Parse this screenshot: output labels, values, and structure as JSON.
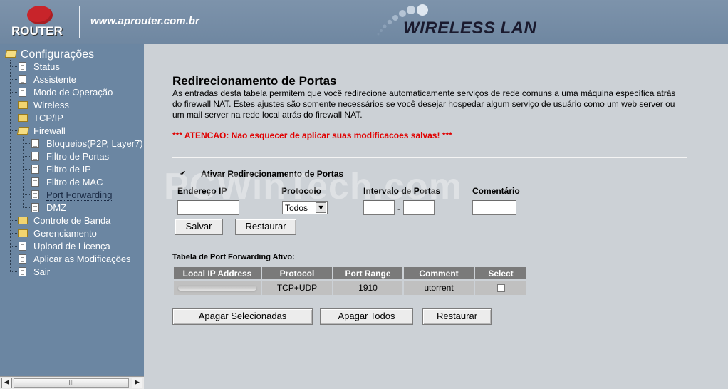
{
  "header": {
    "logo_text": "ROUTER",
    "site_url": "www.aprouter.com.br",
    "product_title": "WIRELESS LAN"
  },
  "sidebar": {
    "root_label": "Configurações",
    "items": [
      {
        "label": "Status"
      },
      {
        "label": "Assistente"
      },
      {
        "label": "Modo de Operação"
      },
      {
        "label": "Wireless"
      },
      {
        "label": "TCP/IP"
      },
      {
        "label": "Firewall"
      },
      {
        "label": "Bloqueios(P2P, Layer7)"
      },
      {
        "label": "Filtro de Portas"
      },
      {
        "label": "Filtro de IP"
      },
      {
        "label": "Filtro de MAC"
      },
      {
        "label": "Port Forwarding"
      },
      {
        "label": "DMZ"
      },
      {
        "label": "Controle de Banda"
      },
      {
        "label": "Gerenciamento"
      },
      {
        "label": "Upload de Licença"
      },
      {
        "label": "Aplicar as Modificações"
      },
      {
        "label": "Sair"
      }
    ],
    "scroll_thumb_glyph": "III"
  },
  "main": {
    "title": "Redirecionamento de Portas",
    "description": "As entradas desta tabela permitem que você redirecione automaticamente serviços de rede comuns a uma máquina específica atrás do firewall NAT. Estes ajustes são somente necessários se você desejar hospedar algum serviço de usuário como um web server ou um mail server na rede local atrás do firewall NAT.",
    "warning": "*** ATENCAO: Nao esquecer de aplicar suas modificacoes salvas! ***",
    "enable_label": "Ativar Redirecionamento de Portas",
    "enable_checked": true,
    "form": {
      "ip_label": "Endereço IP",
      "protocol_label": "Protocolo",
      "range_label": "Intervalo de Portas",
      "comment_label": "Comentário",
      "ip_value": "",
      "protocol_value": "Todos",
      "range_start": "",
      "range_end": "",
      "range_separator": "-",
      "comment_value": ""
    },
    "buttons": {
      "save": "Salvar",
      "reset": "Restaurar"
    },
    "table": {
      "title": "Tabela de Port Forwarding Ativo:",
      "columns": [
        "Local IP Address",
        "Protocol",
        "Port Range",
        "Comment",
        "Select"
      ],
      "rows": [
        {
          "ip": "",
          "protocol": "TCP+UDP",
          "port_range": "1910",
          "comment": "utorrent",
          "selected": false
        }
      ]
    },
    "table_buttons": {
      "delete_selected": "Apagar Selecionadas",
      "delete_all": "Apagar Todos",
      "reset": "Restaurar"
    }
  },
  "watermark": "PCWinTech.com",
  "colors": {
    "header_bg": "#7189a3",
    "sidebar_bg": "#6b86a2",
    "content_bg": "#ccd1d6",
    "warning": "#e00000",
    "table_header": "#7a7a7a"
  }
}
